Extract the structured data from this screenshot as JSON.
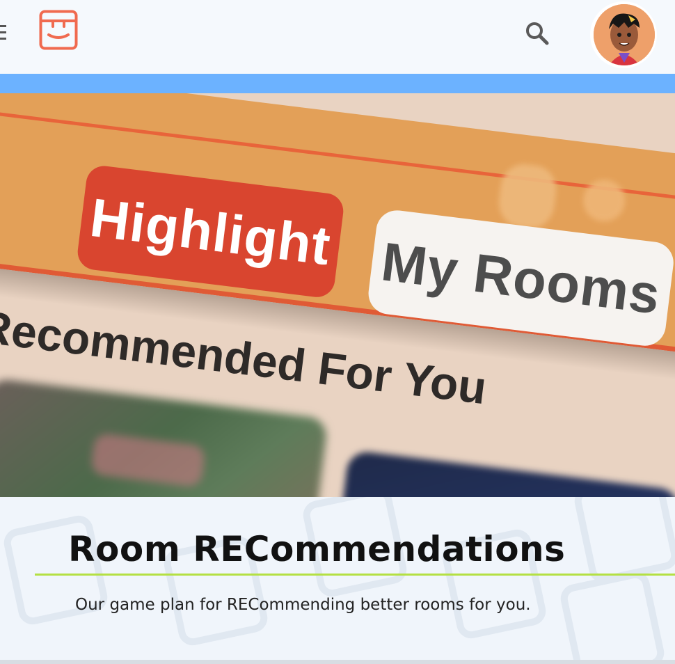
{
  "header": {
    "menu_icon": "hamburger-menu-icon",
    "logo_icon": "rec-room-logo-icon",
    "search_icon": "search-icon",
    "avatar_icon": "user-avatar"
  },
  "colors": {
    "accent_bar": "#6cb2ff",
    "logo": "#f06a4f",
    "highlight_pill": "#d9452f",
    "title_rule": "#b4e043"
  },
  "hero": {
    "tab_highlight": "Highlight",
    "tab_my_rooms": "My Rooms",
    "section_heading": "Recommended For You"
  },
  "card": {
    "title": "Room RECommendations",
    "subtitle": "Our game plan for RECommending better rooms for you."
  }
}
